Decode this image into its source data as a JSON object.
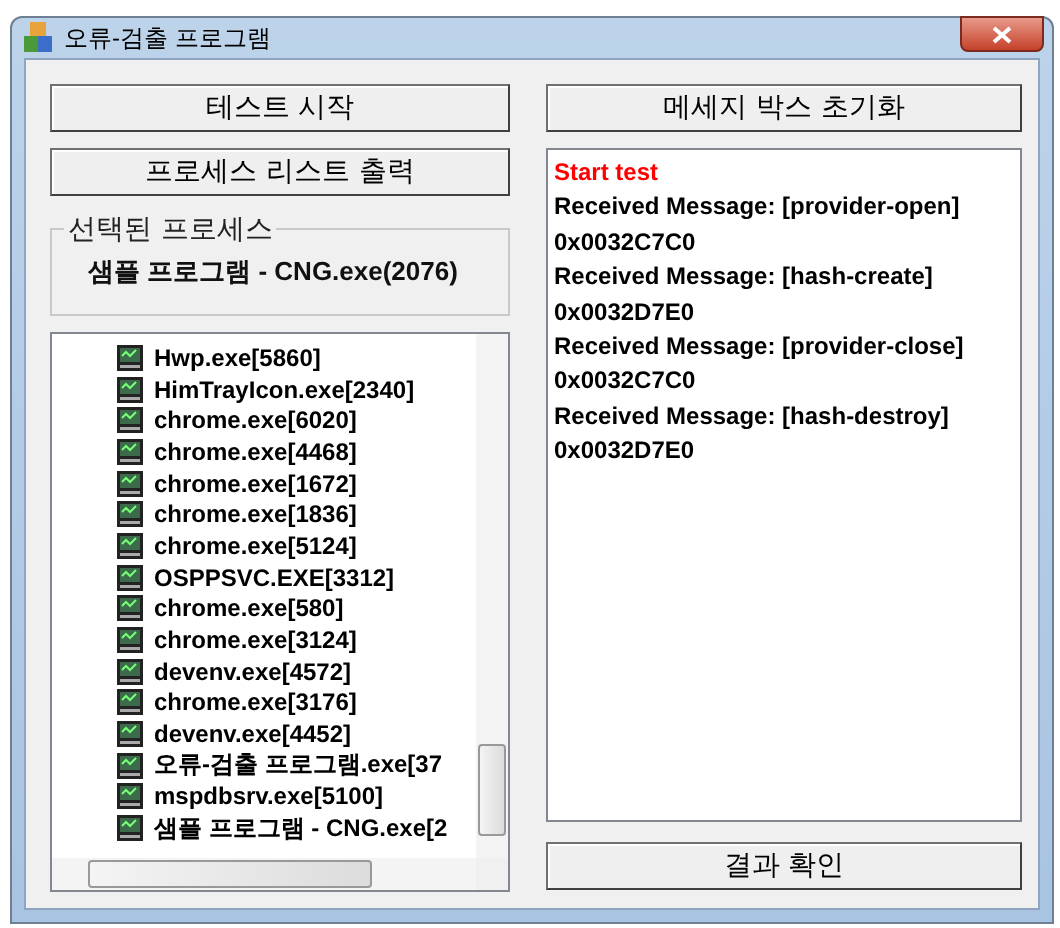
{
  "window": {
    "title": "오류-검출 프로그램"
  },
  "buttons": {
    "start": "테스트 시작",
    "list": "프로세스 리스트 출력",
    "clear": "메세지 박스 초기화",
    "result": "결과 확인"
  },
  "selected_process": {
    "label": "선택된 프로세스",
    "value": "샘플 프로그램 - CNG.exe(2076)"
  },
  "process_list": [
    {
      "name": "Hwp.exe[5860]"
    },
    {
      "name": "HimTrayIcon.exe[2340]"
    },
    {
      "name": "chrome.exe[6020]"
    },
    {
      "name": "chrome.exe[4468]"
    },
    {
      "name": "chrome.exe[1672]"
    },
    {
      "name": "chrome.exe[1836]"
    },
    {
      "name": "chrome.exe[5124]"
    },
    {
      "name": "OSPPSVC.EXE[3312]"
    },
    {
      "name": "chrome.exe[580]"
    },
    {
      "name": "chrome.exe[3124]"
    },
    {
      "name": "devenv.exe[4572]"
    },
    {
      "name": "chrome.exe[3176]"
    },
    {
      "name": "devenv.exe[4452]"
    },
    {
      "name": "오류-검출 프로그램.exe[37"
    },
    {
      "name": "mspdbsrv.exe[5100]"
    },
    {
      "name": "샘플 프로그램 - CNG.exe[2"
    }
  ],
  "messages": [
    {
      "kind": "start",
      "text": "Start test"
    },
    {
      "kind": "message",
      "text": "Received Message: [provider-open]"
    },
    {
      "kind": "message",
      "text": "0x0032C7C0"
    },
    {
      "kind": "message",
      "text": "Received Message: [hash-create]"
    },
    {
      "kind": "message",
      "text": "0x0032D7E0"
    },
    {
      "kind": "message",
      "text": "Received Message: [provider-close]"
    },
    {
      "kind": "message",
      "text": "0x0032C7C0"
    },
    {
      "kind": "message",
      "text": "Received Message: [hash-destroy]"
    },
    {
      "kind": "message",
      "text": "0x0032D7E0"
    }
  ]
}
